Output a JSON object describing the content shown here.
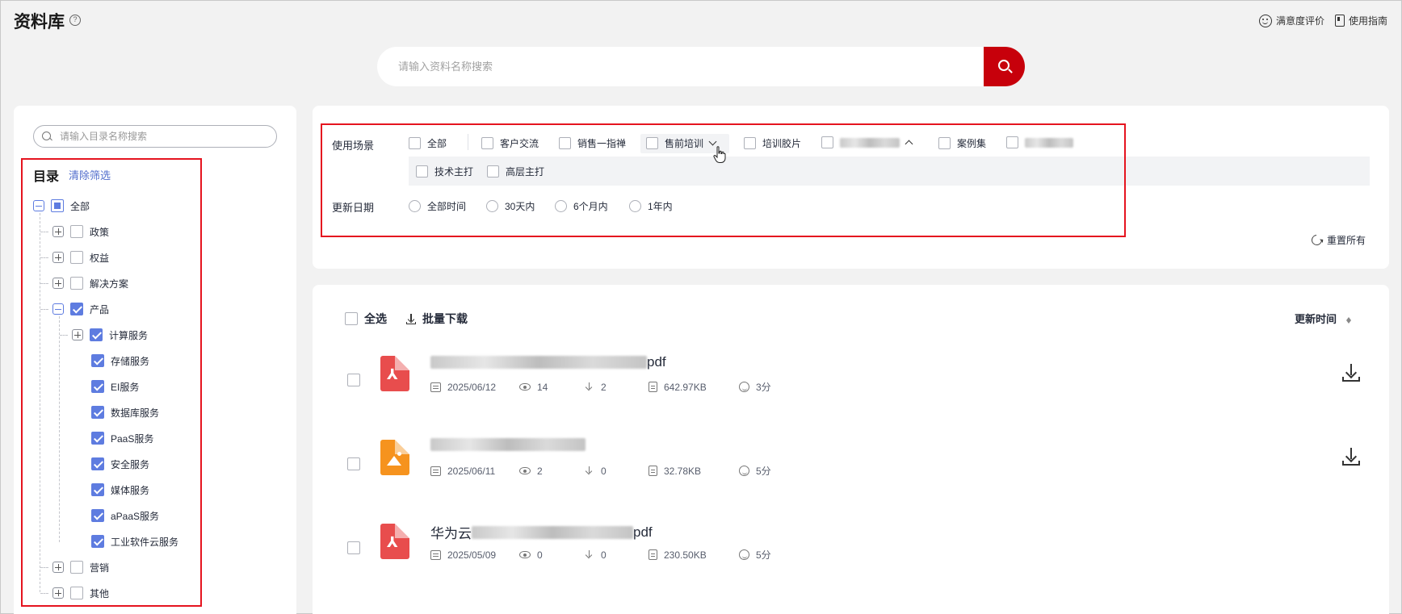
{
  "header": {
    "title": "资料库",
    "help_glyph": "?",
    "satisfaction_label": "满意度评价",
    "guide_label": "使用指南"
  },
  "search": {
    "placeholder": "请输入资料名称搜索"
  },
  "tree": {
    "search_placeholder": "请输入目录名称搜索",
    "title": "目录",
    "clear_label": "清除筛选",
    "root": "全部",
    "nodes": {
      "policy": "政策",
      "rights": "权益",
      "solutions": "解决方案",
      "product": "产品",
      "compute": "计算服务",
      "storage": "存储服务",
      "ei": "EI服务",
      "database": "数据库服务",
      "paas": "PaaS服务",
      "security": "安全服务",
      "media": "媒体服务",
      "apaas": "aPaaS服务",
      "industrial": "工业软件云服务",
      "marketing": "营销",
      "other": "其他"
    }
  },
  "filters": {
    "scene_label": "使用场景",
    "scene_options": {
      "all": "全部",
      "customer": "客户交流",
      "sales_guide": "销售一指禅",
      "presales": "售前培训",
      "training_film": "培训胶片",
      "cases": "案例集",
      "tech": "技术主打",
      "exec": "高层主打"
    },
    "date_label": "更新日期",
    "date_options": {
      "all": "全部时间",
      "d30": "30天内",
      "m6": "6个月内",
      "y1": "1年内"
    },
    "reset_label": "重置所有"
  },
  "list": {
    "select_all": "全选",
    "batch_download": "批量下载",
    "sort_label": "更新时间",
    "files": [
      {
        "name_suffix": "pdf",
        "date": "2025/06/12",
        "views": "14",
        "downloads": "2",
        "size": "642.97KB",
        "score": "3分"
      },
      {
        "name_suffix": "",
        "date": "2025/06/11",
        "views": "2",
        "downloads": "0",
        "size": "32.78KB",
        "score": "5分"
      },
      {
        "name_prefix": "华为云",
        "name_suffix": "pdf",
        "date": "2025/05/09",
        "views": "0",
        "downloads": "0",
        "size": "230.50KB",
        "score": "5分"
      }
    ]
  },
  "colors": {
    "accent_red": "#c7000b",
    "highlight_border": "#e5141f",
    "checkbox_blue": "#5e7ce0",
    "pdf_red": "#e84d4d",
    "image_orange": "#f6931e"
  },
  "icons": [
    "help-icon",
    "smile-icon",
    "book-icon",
    "search-icon",
    "reset-icon",
    "download-icon",
    "calendar-icon",
    "eye-icon",
    "file-size-icon",
    "face-icon",
    "pdf-icon",
    "image-icon",
    "cursor-icon"
  ]
}
